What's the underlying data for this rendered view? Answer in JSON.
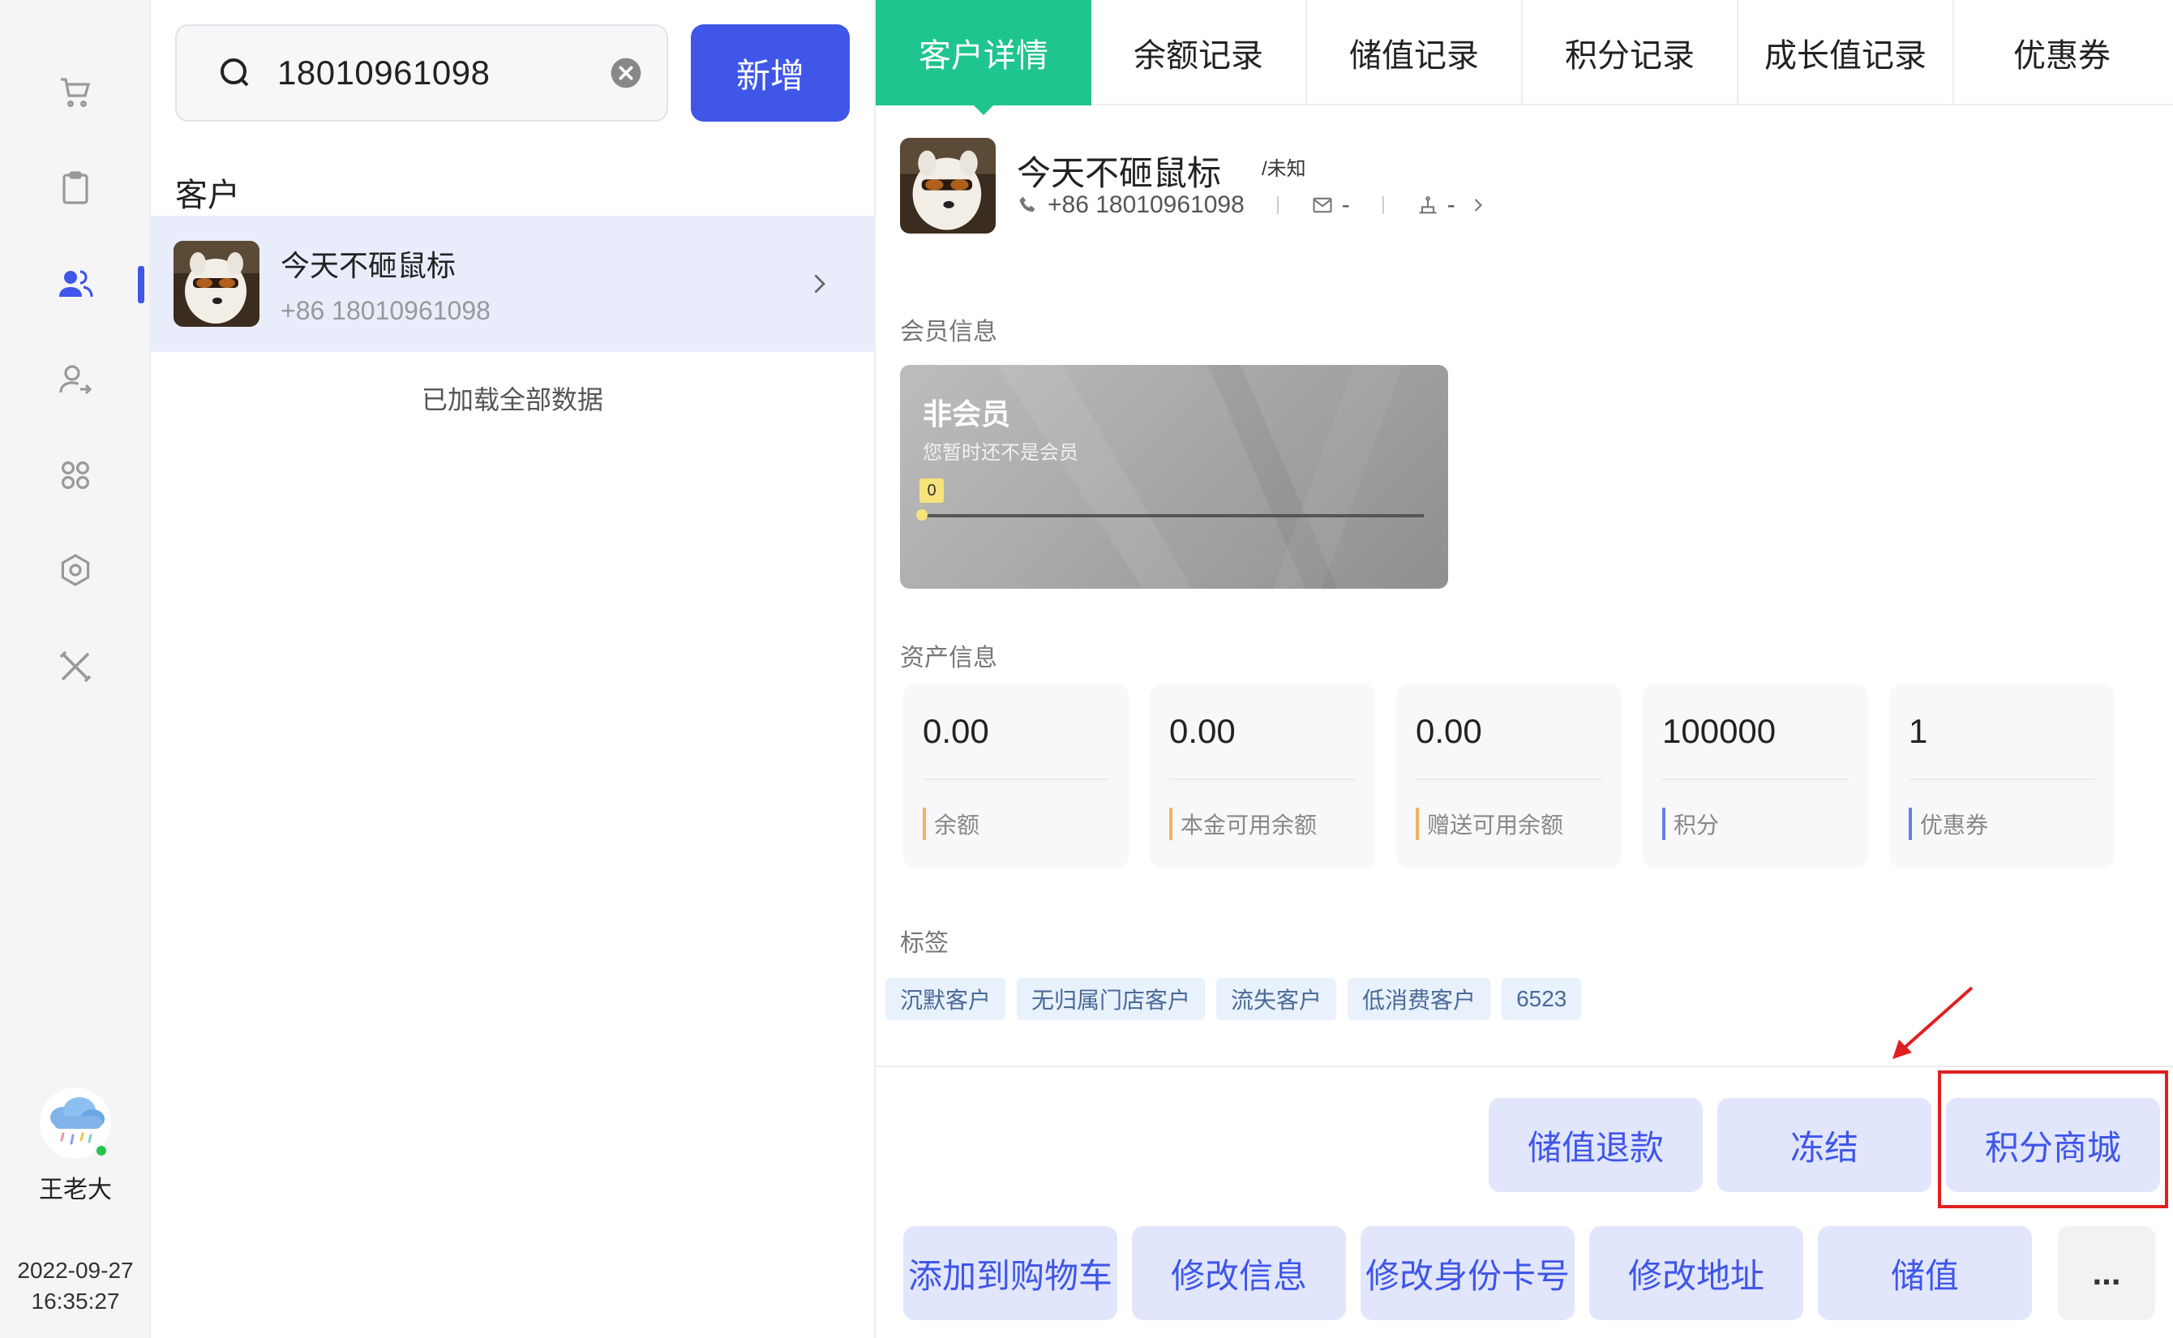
{
  "nav": {
    "items": [
      "cart-icon",
      "clipboard-icon",
      "customers-icon",
      "user-transfer-icon",
      "apps-icon",
      "gear-icon",
      "tools-icon"
    ],
    "active_index": 2
  },
  "user": {
    "name": "王老大",
    "date": "2022-09-27",
    "time": "16:35:27"
  },
  "search": {
    "value": "18010961098",
    "add_label": "新增"
  },
  "list": {
    "section_label": "客户",
    "customers": [
      {
        "name": "今天不砸鼠标",
        "phone": "+86 18010961098"
      }
    ],
    "loaded_text": "已加载全部数据"
  },
  "tabs": [
    "客户详情",
    "余额记录",
    "储值记录",
    "积分记录",
    "成长值记录",
    "优惠券"
  ],
  "profile": {
    "name": "今天不砸鼠标",
    "gender": "/未知",
    "phone": "+86 18010961098",
    "email": "-",
    "org": "-"
  },
  "member": {
    "section_label": "会员信息",
    "title": "非会员",
    "subtitle": "您暂时还不是会员",
    "level_value": "0"
  },
  "assets": {
    "section_label": "资产信息",
    "items": [
      {
        "value": "0.00",
        "label": "余额",
        "color": "#f5b25a"
      },
      {
        "value": "0.00",
        "label": "本金可用余额",
        "color": "#f5b25a"
      },
      {
        "value": "0.00",
        "label": "赠送可用余额",
        "color": "#f5b25a"
      },
      {
        "value": "100000",
        "label": "积分",
        "color": "#6b7ee8"
      },
      {
        "value": "1",
        "label": "优惠券",
        "color": "#6b7ee8"
      }
    ]
  },
  "tags": {
    "section_label": "标签",
    "items": [
      "沉默客户",
      "无归属门店客户",
      "流失客户",
      "低消费客户",
      "6523"
    ]
  },
  "actions": {
    "row1": [
      "储值退款",
      "冻结",
      "积分商城"
    ],
    "row2": [
      "添加到购物车",
      "修改信息",
      "修改身份卡号",
      "修改地址",
      "储值"
    ],
    "more": "..."
  },
  "colors": {
    "accent": "#3f56e8",
    "tab_active": "#1fc58e",
    "highlight": "#e02020"
  }
}
